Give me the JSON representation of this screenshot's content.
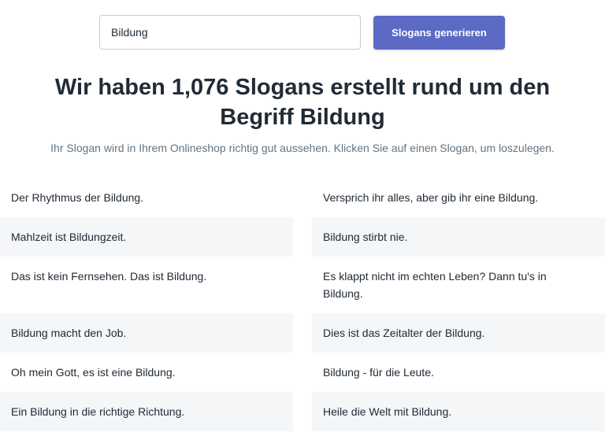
{
  "search": {
    "value": "Bildung",
    "button_label": "Slogans generieren"
  },
  "headline": "Wir haben 1,076 Slogans erstellt rund um den Begriff Bildung",
  "subtext": "Ihr Slogan wird in Ihrem Onlineshop richtig gut aussehen. Klicken Sie auf einen Slogan, um loszulegen.",
  "slogans": [
    "Der Rhythmus der Bildung.",
    "Versprich ihr alles, aber gib ihr eine Bildung.",
    "Mahlzeit ist Bildungzeit.",
    "Bildung stirbt nie.",
    "Das ist kein Fernsehen. Das ist Bildung.",
    "Es klappt nicht im echten Leben? Dann tu's in Bildung.",
    "Bildung macht den Job.",
    "Dies ist das Zeitalter der Bildung.",
    "Oh mein Gott, es ist eine Bildung.",
    "Bildung - für die Leute.",
    "Ein Bildung in die richtige Richtung.",
    "Heile die Welt mit Bildung."
  ],
  "colors": {
    "accent": "#5c6ac4",
    "row_shade": "#f4f6f8",
    "subtext": "#637381"
  }
}
